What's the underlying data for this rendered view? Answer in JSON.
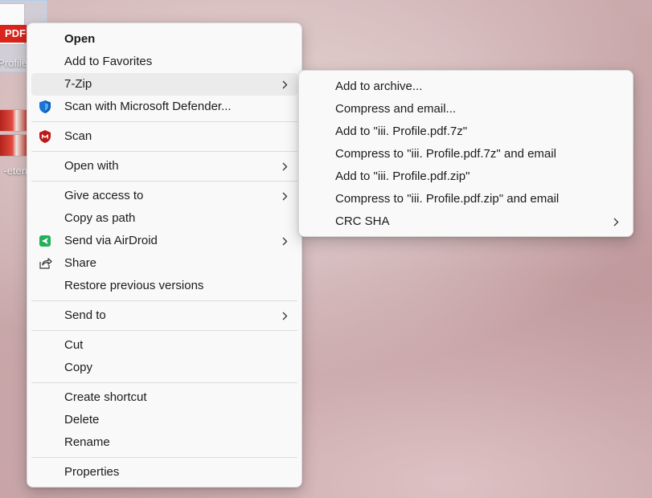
{
  "desktop": {
    "icons": [
      {
        "badge": "PDF",
        "label": "Profile"
      },
      {
        "label": "eten-"
      }
    ]
  },
  "context_menu": {
    "items": [
      {
        "label": "Open"
      },
      {
        "label": "Add to Favorites"
      },
      {
        "label": "7-Zip"
      },
      {
        "label": "Scan with Microsoft Defender..."
      },
      {
        "label": "Scan"
      },
      {
        "label": "Open with"
      },
      {
        "label": "Give access to"
      },
      {
        "label": "Copy as path"
      },
      {
        "label": "Send via AirDroid"
      },
      {
        "label": "Share"
      },
      {
        "label": "Restore previous versions"
      },
      {
        "label": "Send to"
      },
      {
        "label": "Cut"
      },
      {
        "label": "Copy"
      },
      {
        "label": "Create shortcut"
      },
      {
        "label": "Delete"
      },
      {
        "label": "Rename"
      },
      {
        "label": "Properties"
      }
    ]
  },
  "zip_submenu": {
    "items": [
      {
        "label": "Add to archive..."
      },
      {
        "label": "Compress and email..."
      },
      {
        "label": "Add to \"iii. Profile.pdf.7z\""
      },
      {
        "label": "Compress to \"iii. Profile.pdf.7z\" and email"
      },
      {
        "label": "Add to \"iii. Profile.pdf.zip\""
      },
      {
        "label": "Compress to \"iii. Profile.pdf.zip\" and email"
      },
      {
        "label": "CRC SHA"
      }
    ]
  },
  "colors": {
    "defender_blue": "#1a73d9",
    "mcafee_red": "#c01818",
    "airdroid_green": "#21b15a"
  }
}
